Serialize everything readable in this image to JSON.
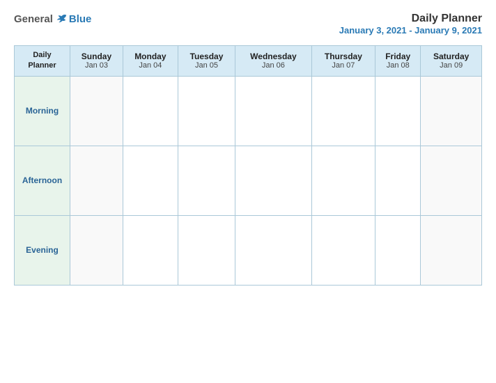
{
  "logo": {
    "general": "General",
    "blue": "Blue"
  },
  "title": {
    "main": "Daily Planner",
    "sub": "January 3, 2021 - January 9, 2021"
  },
  "header_row": {
    "label_line1": "Daily",
    "label_line2": "Planner",
    "days": [
      {
        "name": "Sunday",
        "date": "Jan 03"
      },
      {
        "name": "Monday",
        "date": "Jan 04"
      },
      {
        "name": "Tuesday",
        "date": "Jan 05"
      },
      {
        "name": "Wednesday",
        "date": "Jan 06"
      },
      {
        "name": "Thursday",
        "date": "Jan 07"
      },
      {
        "name": "Friday",
        "date": "Jan 08"
      },
      {
        "name": "Saturday",
        "date": "Jan 09"
      }
    ]
  },
  "time_slots": [
    {
      "label": "Morning"
    },
    {
      "label": "Afternoon"
    },
    {
      "label": "Evening"
    }
  ]
}
